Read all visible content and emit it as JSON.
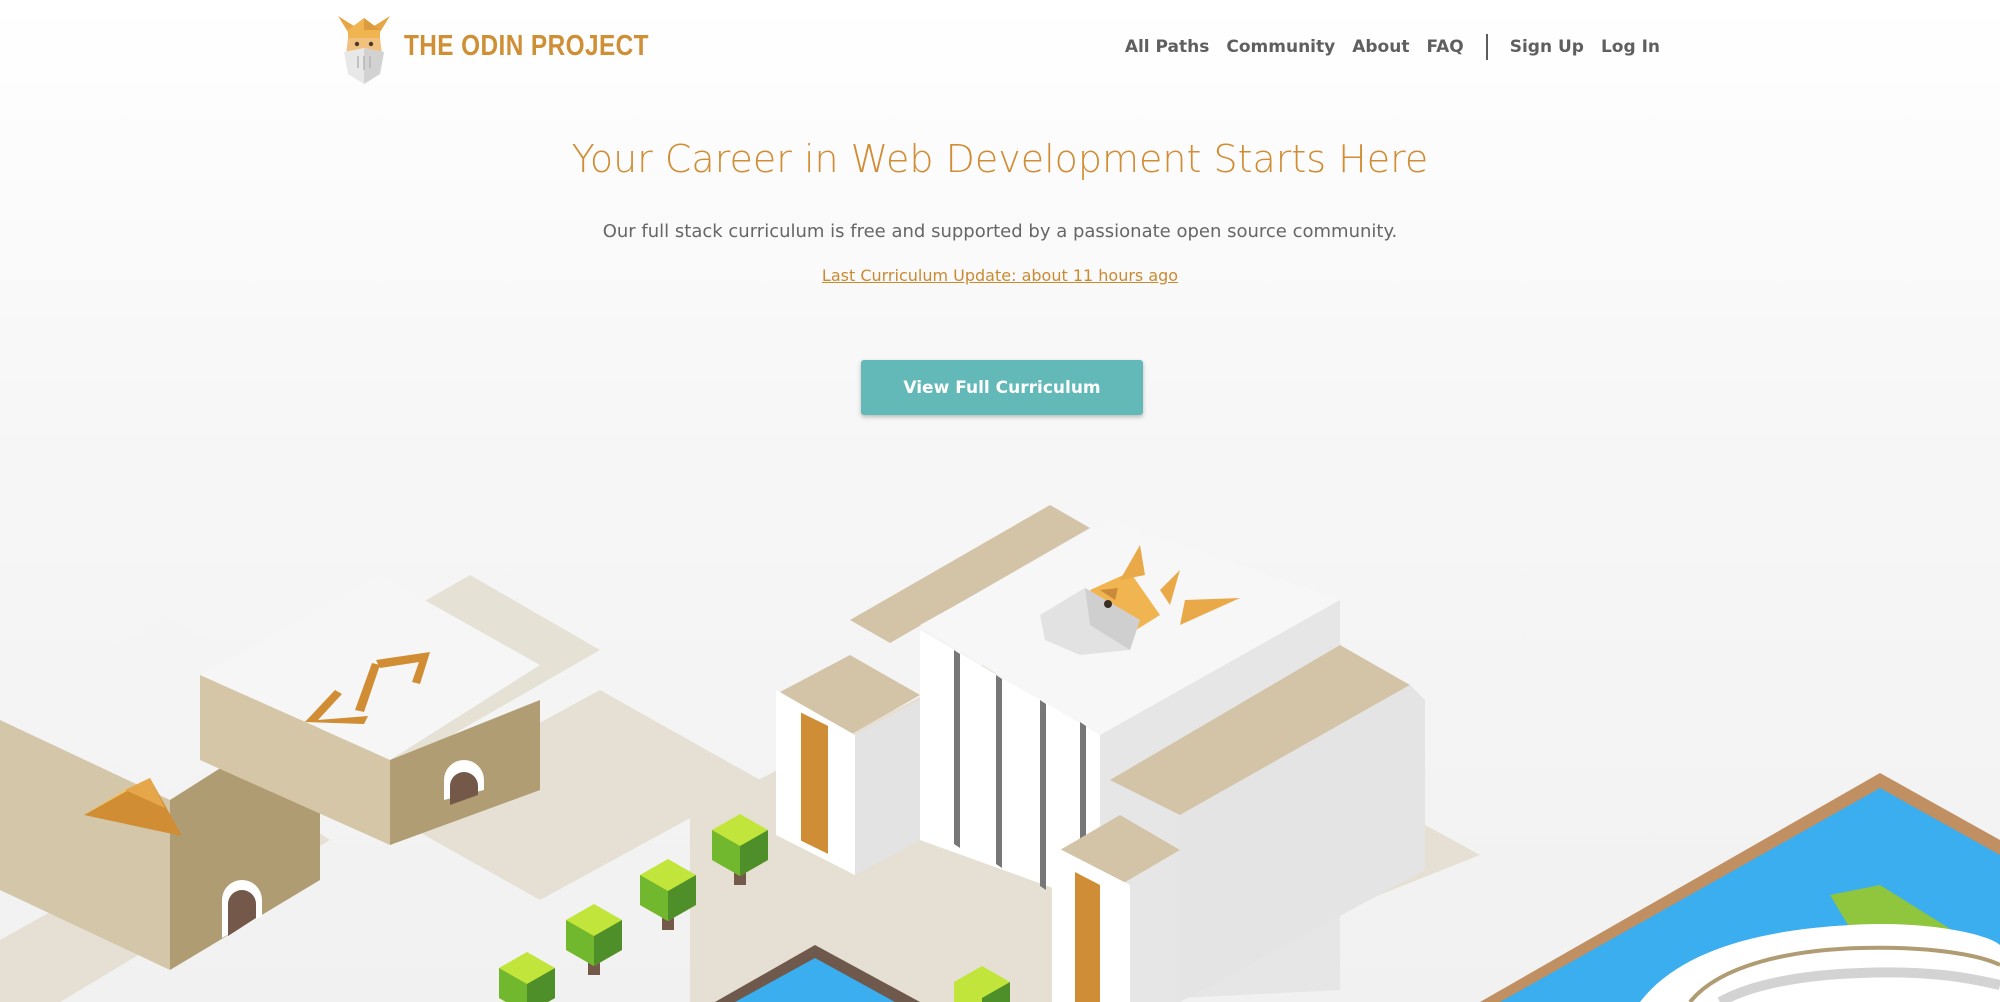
{
  "brand": {
    "name": "THE ODIN PROJECT",
    "logo_icon": "odin-viking-icon"
  },
  "nav": {
    "links": [
      "All Paths",
      "Community",
      "About",
      "FAQ"
    ],
    "auth": [
      "Sign Up",
      "Log In"
    ]
  },
  "hero": {
    "title": "Your Career in Web Development Starts Here",
    "subtitle": "Our full stack curriculum is free and supported by a passionate open source community.",
    "update_link": "Last Curriculum Update: about 11 hours ago",
    "cta_label": "View Full Curriculum"
  },
  "colors": {
    "brand_orange": "#ce8f35",
    "cta_teal": "#62b9b8",
    "nav_text": "#5f5f5f",
    "water_blue": "#3aaeee"
  },
  "illustration": {
    "subject": "isometric-campus-illustration",
    "code_glyph": "code-brackets-icon"
  }
}
